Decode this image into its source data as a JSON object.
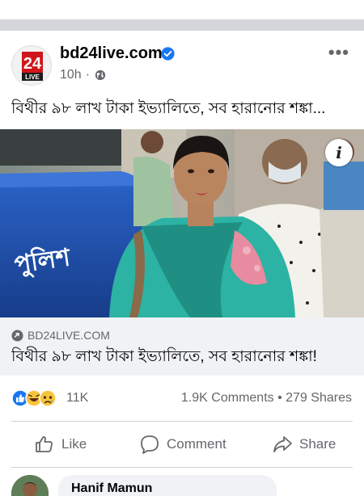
{
  "post": {
    "page_name": "bd24live.com",
    "time": "10h",
    "meta_separator": "·",
    "avatar": {
      "badge_number": "24",
      "badge_word": "LIVE"
    },
    "text": "বিথীর ৯৮ লাখ টাকা ইভ্যালিতে, সব হারানোর শঙ্কা...",
    "photo_caption_sign": "পুলিশ",
    "link": {
      "domain": "BD24LIVE.COM",
      "title": "বিথীর ৯৮ লাখ টাকা ইভ্যালিতে, সব হারানোর শঙ্কা!"
    }
  },
  "engagement": {
    "reaction_count": "11K",
    "comments": "1.9K Comments",
    "dot": "•",
    "shares": "279 Shares"
  },
  "actions": {
    "like": "Like",
    "comment": "Comment",
    "share": "Share"
  },
  "comment_preview": {
    "name": "Hanif Mamun"
  },
  "icons": {
    "more": "more-options-icon",
    "verified": "verified-badge-icon",
    "globe": "globe-icon",
    "info": "info-icon",
    "link": "link-icon",
    "like": "thumbs-up-icon",
    "comment": "speech-bubble-icon",
    "share": "share-arrow-icon"
  },
  "colors": {
    "facebook_blue": "#1877f2",
    "brand_red": "#d0161b",
    "secondary_text": "#65676b",
    "link_preview_bg": "#f0f2f5"
  }
}
